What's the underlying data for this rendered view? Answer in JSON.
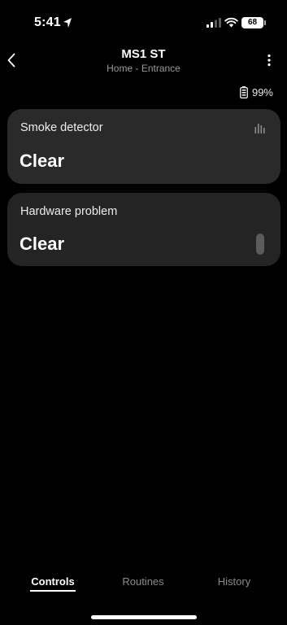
{
  "status_bar": {
    "time": "5:41",
    "battery_level": "68",
    "location_icon": "location-arrow-icon",
    "signal_icon": "cellular-signal-icon",
    "wifi_icon": "wifi-icon"
  },
  "header": {
    "title": "MS1 ST",
    "subtitle": "Home - Entrance",
    "back_icon": "chevron-left-icon",
    "more_icon": "more-vertical-icon"
  },
  "device_battery": {
    "value": "99%",
    "icon": "battery-icon"
  },
  "cards": [
    {
      "label": "Smoke detector",
      "value": "Clear",
      "icon": "bar-chart-icon"
    },
    {
      "label": "Hardware problem",
      "value": "Clear"
    }
  ],
  "tabs": [
    {
      "label": "Controls",
      "active": true
    },
    {
      "label": "Routines",
      "active": false
    },
    {
      "label": "History",
      "active": false
    }
  ],
  "colors": {
    "background": "#000000",
    "card": "#2a2a2a",
    "text_primary": "#ffffff",
    "text_secondary": "#9a9a9a"
  }
}
